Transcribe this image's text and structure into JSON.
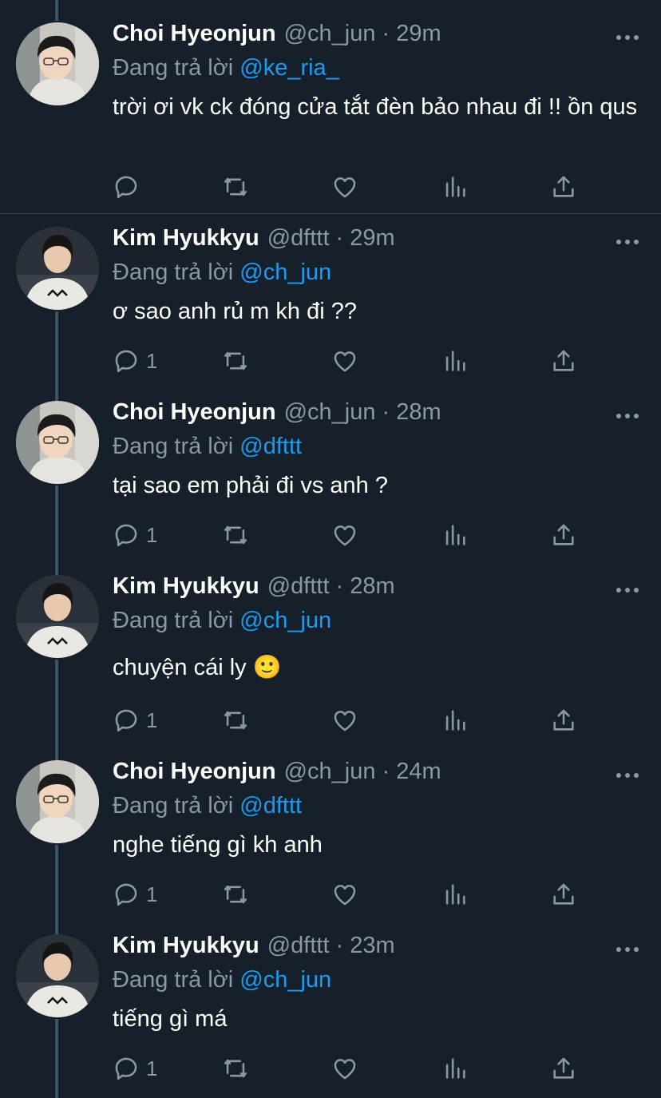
{
  "tweets": [
    {
      "author": "Choi Hyeonjun",
      "handle": "@ch_jun",
      "time": "29m",
      "reply_prefix": "Đang trả lời",
      "reply_to": "@ke_ria_",
      "text": "trời ơi vk ck đóng cửa tắt đèn bảo nhau đi !! ồn qus",
      "reply_count": "",
      "avatar": "choi-avatar"
    },
    {
      "author": "Kim Hyukkyu",
      "handle": "@dfttt",
      "time": "29m",
      "reply_prefix": "Đang trả lời",
      "reply_to": "@ch_jun",
      "text": "ơ sao anh rủ m kh đi ??",
      "reply_count": "1",
      "avatar": "kim-avatar"
    },
    {
      "author": "Choi Hyeonjun",
      "handle": "@ch_jun",
      "time": "28m",
      "reply_prefix": "Đang trả lời",
      "reply_to": "@dfttt",
      "text": "tại sao em phải đi vs anh ?",
      "reply_count": "1",
      "avatar": "choi-avatar"
    },
    {
      "author": "Kim Hyukkyu",
      "handle": "@dfttt",
      "time": "28m",
      "reply_prefix": "Đang trả lời",
      "reply_to": "@ch_jun",
      "text": "chuyện cái ly 🙂",
      "reply_count": "1",
      "avatar": "kim-avatar"
    },
    {
      "author": "Choi Hyeonjun",
      "handle": "@ch_jun",
      "time": "24m",
      "reply_prefix": "Đang trả lời",
      "reply_to": "@dfttt",
      "text": "nghe tiếng gì kh anh",
      "reply_count": "1",
      "avatar": "choi-avatar"
    },
    {
      "author": "Kim Hyukkyu",
      "handle": "@dfttt",
      "time": "23m",
      "reply_prefix": "Đang trả lời",
      "reply_to": "@ch_jun",
      "text": "tiếng gì má",
      "reply_count": "1",
      "avatar": "kim-avatar"
    }
  ],
  "separator": "·",
  "icons": [
    "reply-icon",
    "retweet-icon",
    "like-icon",
    "analytics-icon",
    "share-icon",
    "more-icon"
  ],
  "colors": {
    "background": "#15202b",
    "secondary_text": "#8b98a5",
    "mention": "#1d9bf0",
    "thread_line": "#3d5466",
    "divider": "#38444d"
  }
}
